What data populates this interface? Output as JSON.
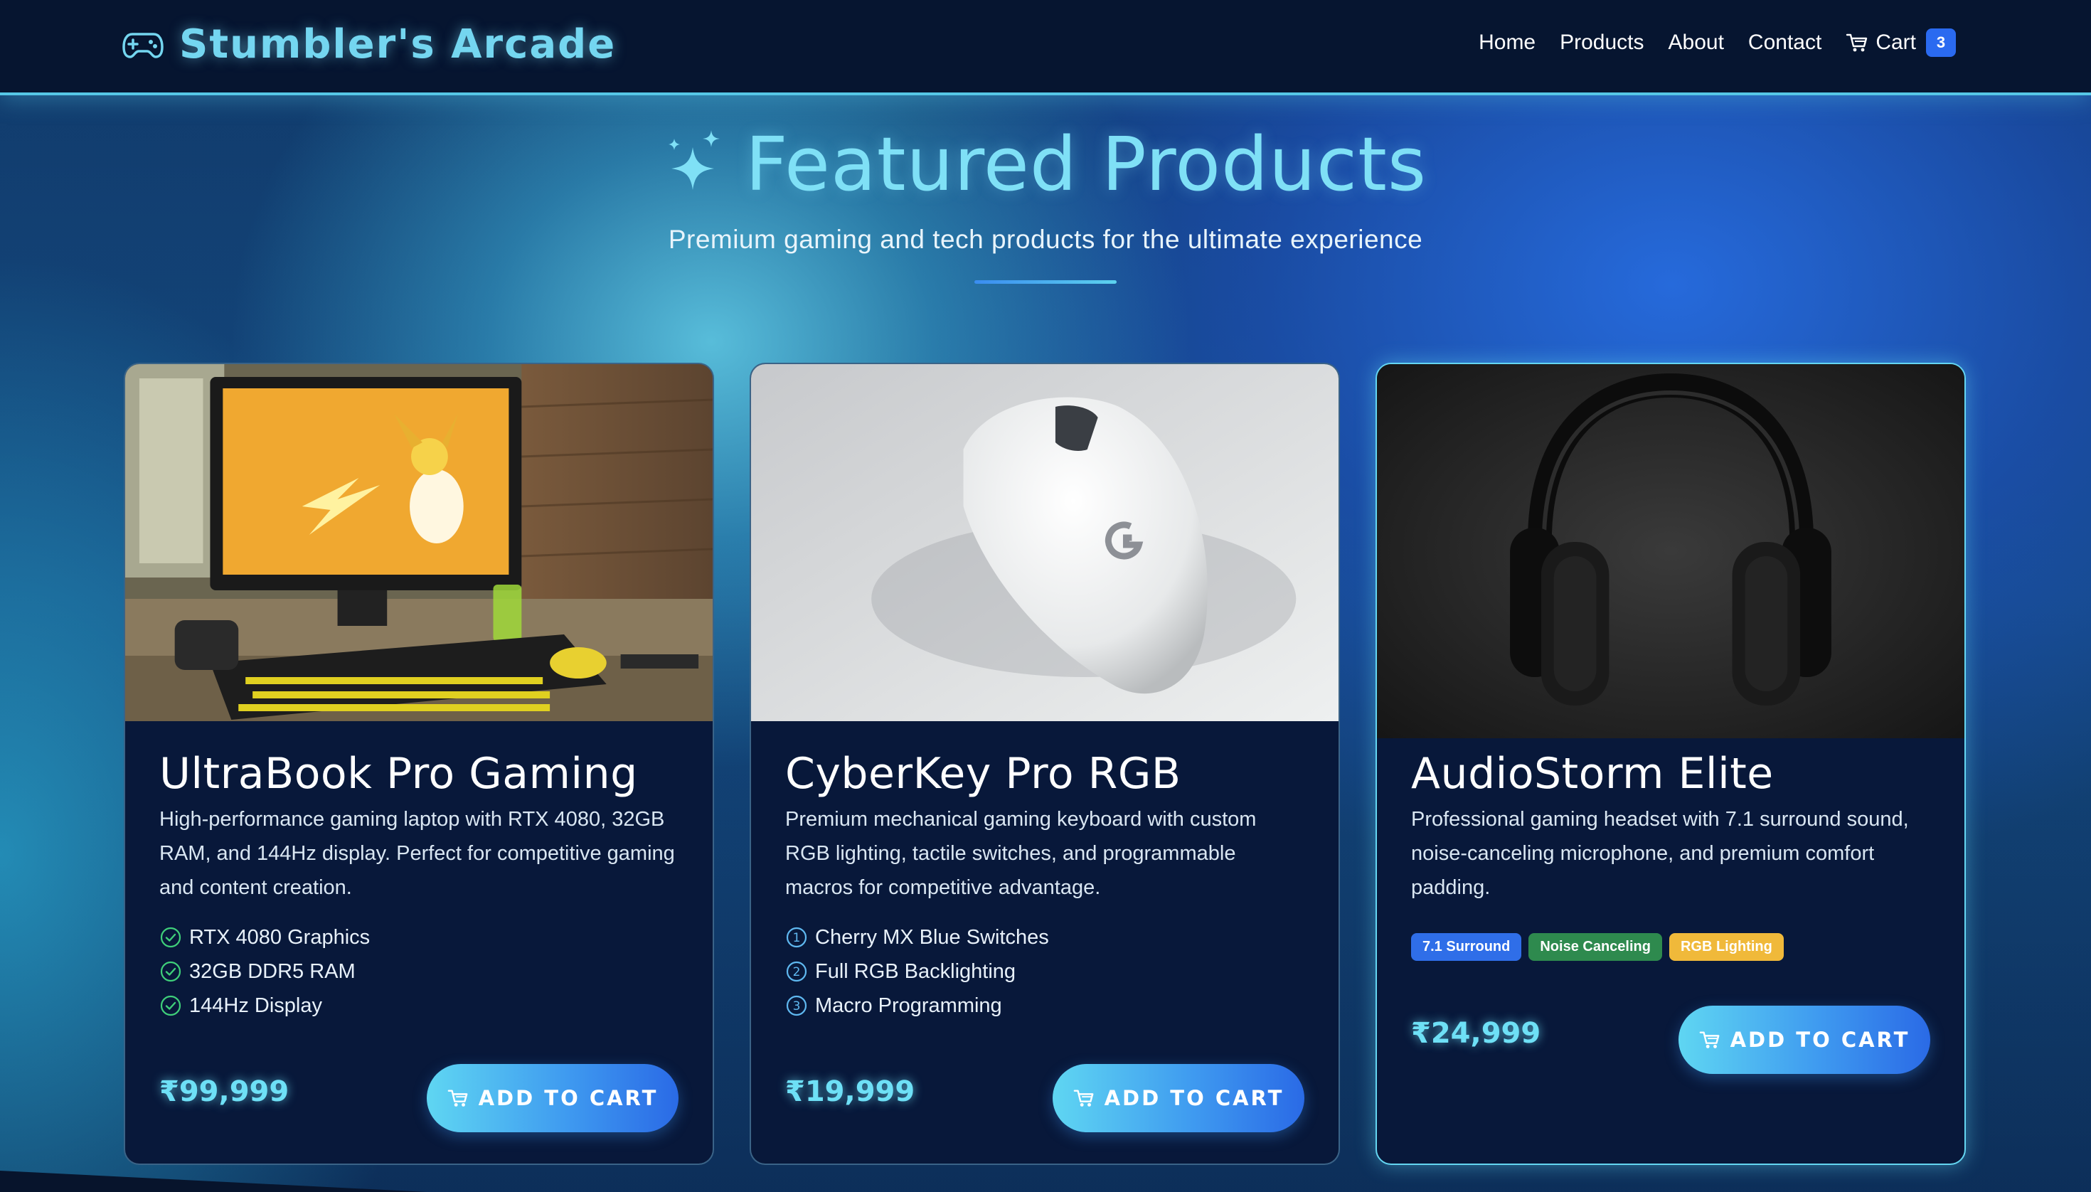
{
  "brand": {
    "name": "Stumbler's Arcade",
    "icon": "gamepad-icon"
  },
  "nav": {
    "links": [
      "Home",
      "Products",
      "About",
      "Contact"
    ],
    "cart_label": "Cart",
    "cart_count": "3",
    "cart_icon": "cart-icon"
  },
  "header": {
    "title": "Featured Products",
    "subtitle": "Premium gaming and tech products for the ultimate experience",
    "icon": "sparkles-icon"
  },
  "products": [
    {
      "title": "UltraBook Pro Gaming",
      "description": "High-performance gaming laptop with RTX 4080, 32GB RAM, and 144Hz display. Perfect for competitive gaming and content creation.",
      "features": [
        "RTX 4080 Graphics",
        "32GB DDR5 RAM",
        "144Hz Display"
      ],
      "feature_icon": "check-circle-icon",
      "price": "₹99,999",
      "button_label": "ADD TO CART",
      "image": "gaming-monitor-desk-photo"
    },
    {
      "title": "CyberKey Pro RGB",
      "description": "Premium mechanical gaming keyboard with custom RGB lighting, tactile switches, and programmable macros for competitive advantage.",
      "features": [
        "Cherry MX Blue Switches",
        "Full RGB Backlighting",
        "Macro Programming"
      ],
      "feature_icon": "numbered-circle-icon",
      "feature_numbers": [
        "1",
        "2",
        "3"
      ],
      "price": "₹19,999",
      "button_label": "ADD TO CART",
      "image": "white-mouse-photo"
    },
    {
      "title": "AudioStorm Elite",
      "description": "Professional gaming headset with 7.1 surround sound, noise-canceling microphone, and premium comfort padding.",
      "tags": [
        {
          "label": "7.1 Surround",
          "color": "#2f6ee8"
        },
        {
          "label": "Noise Canceling",
          "color": "#2e8a4e"
        },
        {
          "label": "RGB Lighting",
          "color": "#f0b93a"
        }
      ],
      "price": "₹24,999",
      "button_label": "ADD TO CART",
      "image": "black-headphones-photo"
    }
  ],
  "colors": {
    "accent": "#56c7e6",
    "navbar_bg": "#061530",
    "card_bg": "#08183a",
    "badge": "#2a6af0",
    "price": "#6ee0f6"
  }
}
